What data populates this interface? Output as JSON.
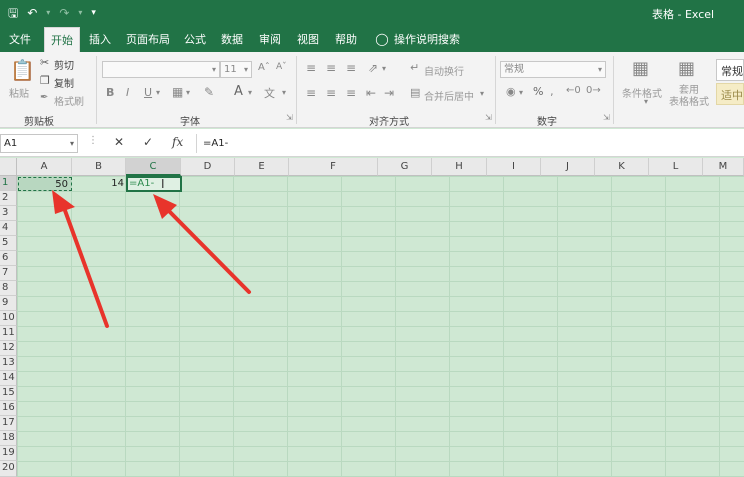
{
  "window": {
    "title": "表格  -  Excel"
  },
  "qat": {
    "save_icon": "save-icon",
    "undo_icon": "undo-icon",
    "redo_icon": "redo-icon",
    "customize_icon": "customize-icon"
  },
  "tabs": [
    {
      "label": "文件"
    },
    {
      "label": "开始",
      "active": true
    },
    {
      "label": "插入"
    },
    {
      "label": "页面布局"
    },
    {
      "label": "公式"
    },
    {
      "label": "数据"
    },
    {
      "label": "审阅"
    },
    {
      "label": "视图"
    },
    {
      "label": "帮助"
    },
    {
      "label": "操作说明搜索"
    }
  ],
  "ribbon": {
    "clipboard": {
      "label": "剪贴板",
      "paste": "粘贴",
      "cut": "剪切",
      "copy": "复制",
      "format_painter": "格式刷"
    },
    "font": {
      "label": "字体",
      "size": "11",
      "bold": "B",
      "italic": "I",
      "underline": "U"
    },
    "alignment": {
      "label": "对齐方式",
      "wrap": "自动换行",
      "merge": "合并后居中"
    },
    "number": {
      "label": "数字",
      "format": "常规",
      "percent": "%"
    },
    "styles": {
      "conditional": "条件格式",
      "table_format": "套用\n表格格式",
      "normal": "常规",
      "moderate": "适中"
    }
  },
  "formula_bar": {
    "name_box": "A1",
    "cancel": "✕",
    "enter": "✓",
    "fx": "fx",
    "content": "=A1-"
  },
  "sheet": {
    "columns": [
      "A",
      "B",
      "C",
      "D",
      "E",
      "F",
      "G",
      "H",
      "I",
      "J",
      "K",
      "L",
      "M"
    ],
    "rows": [
      "1",
      "2",
      "3",
      "4",
      "5",
      "6",
      "7",
      "8",
      "9",
      "10",
      "11",
      "12",
      "13",
      "14",
      "15",
      "16",
      "17",
      "18",
      "19",
      "20"
    ],
    "a1": "50",
    "b1": "14",
    "c1": "=A1-"
  },
  "colors": {
    "accent": "#217346",
    "arrow": "#e8342b"
  }
}
